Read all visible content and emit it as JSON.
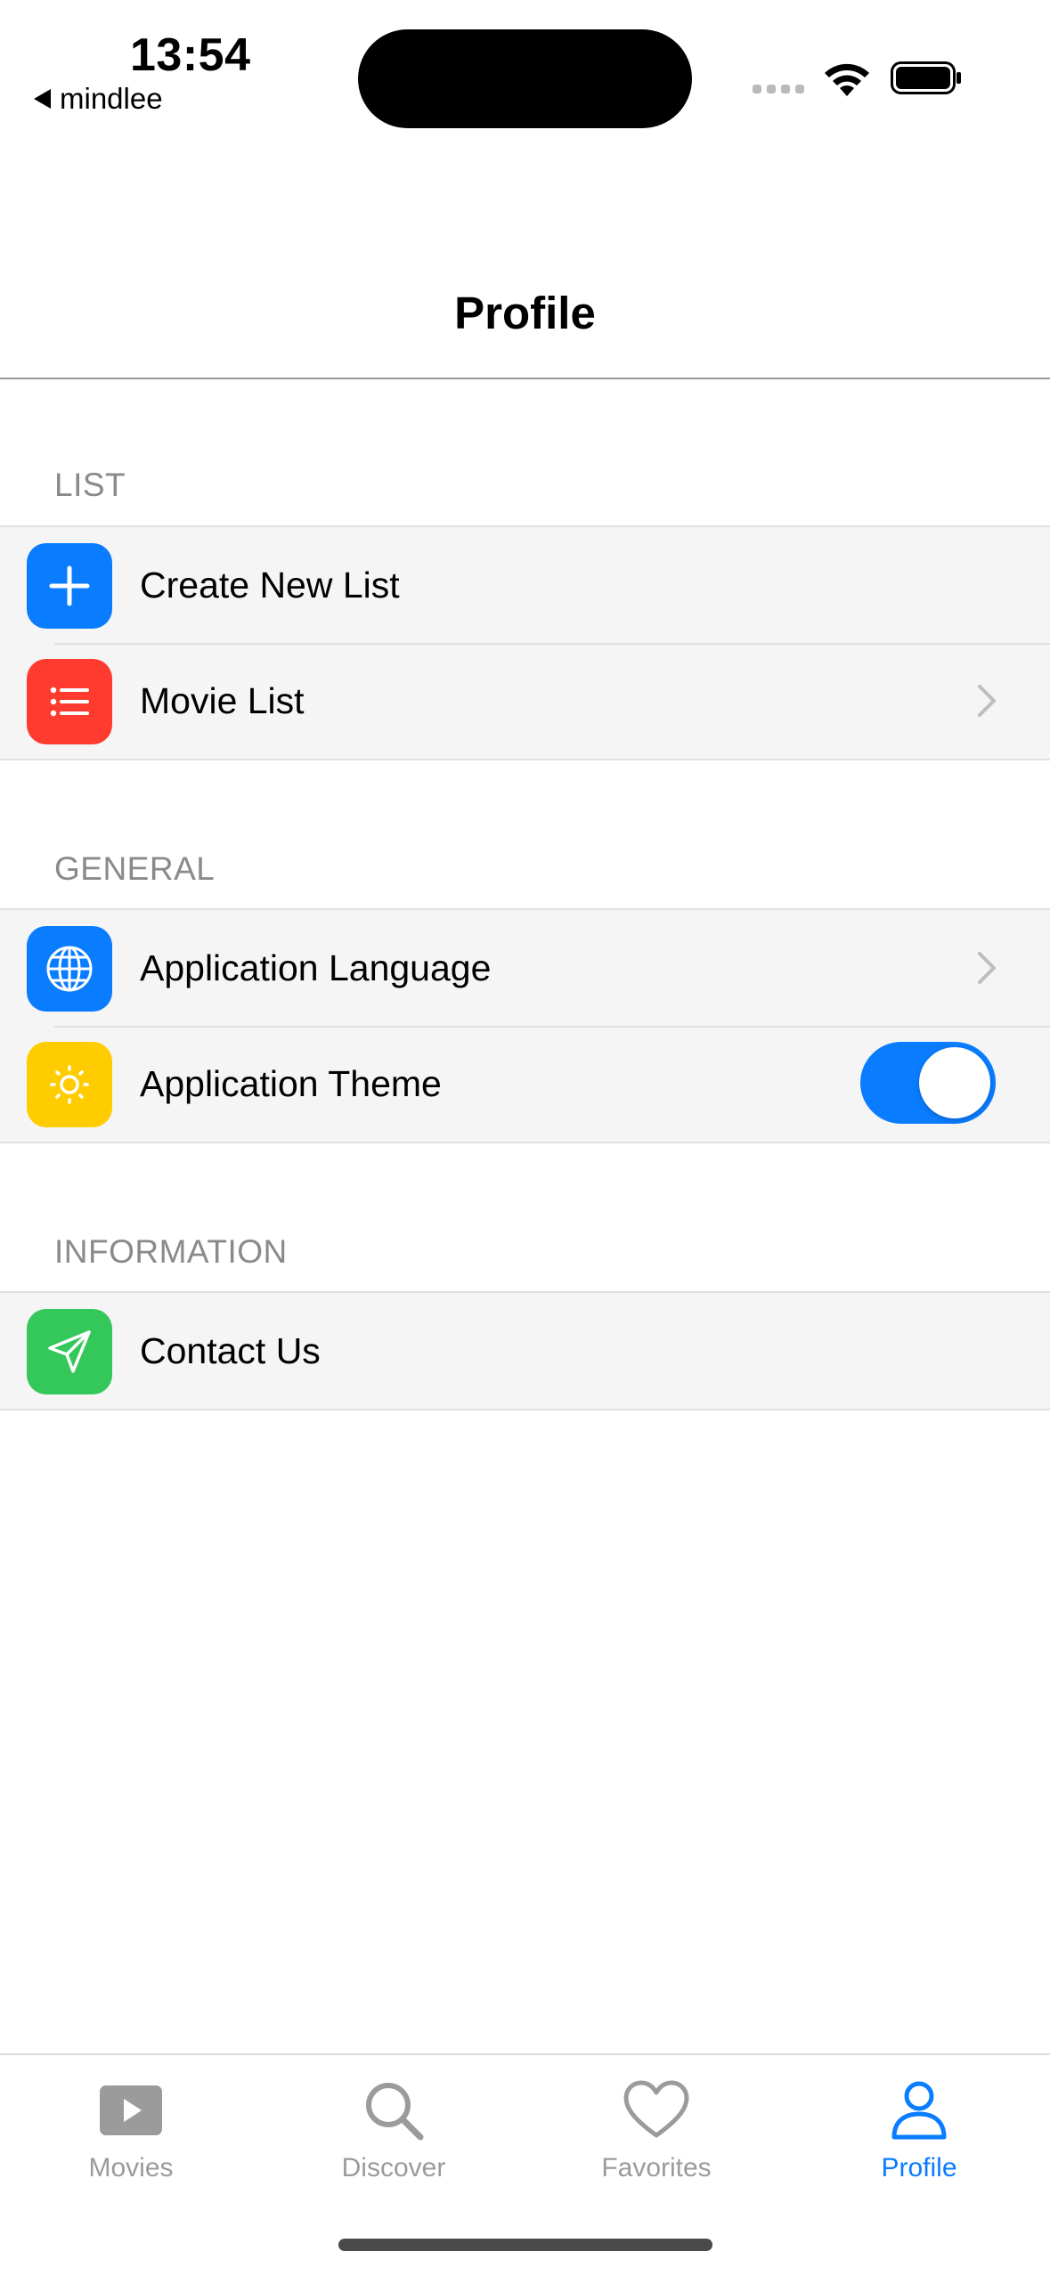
{
  "status_bar": {
    "time": "13:54",
    "back_app": "mindlee"
  },
  "nav": {
    "title": "Profile"
  },
  "sections": [
    {
      "header": "LIST",
      "rows": [
        {
          "label": "Create New List",
          "icon": "plus-icon",
          "color": "#0a7cff",
          "accessory": "none"
        },
        {
          "label": "Movie List",
          "icon": "list-icon",
          "color": "#ff3b30",
          "accessory": "chevron"
        }
      ]
    },
    {
      "header": "GENERAL",
      "rows": [
        {
          "label": "Application Language",
          "icon": "globe-icon",
          "color": "#0a7cff",
          "accessory": "chevron"
        },
        {
          "label": "Application Theme",
          "icon": "sun-icon",
          "color": "#ffcc00",
          "accessory": "toggle",
          "toggle_on": true
        }
      ]
    },
    {
      "header": "INFORMATION",
      "rows": [
        {
          "label": "Contact Us",
          "icon": "send-icon",
          "color": "#34c759",
          "accessory": "none"
        }
      ]
    }
  ],
  "tabs": [
    {
      "label": "Movies",
      "icon": "play-icon",
      "active": false
    },
    {
      "label": "Discover",
      "icon": "search-icon",
      "active": false
    },
    {
      "label": "Favorites",
      "icon": "heart-icon",
      "active": false
    },
    {
      "label": "Profile",
      "icon": "person-icon",
      "active": true
    }
  ],
  "colors": {
    "accent": "#0a7cff",
    "inactive_tab": "#9b9b9b",
    "row_background": "#f5f5f5",
    "section_header": "#8a8a8e"
  }
}
